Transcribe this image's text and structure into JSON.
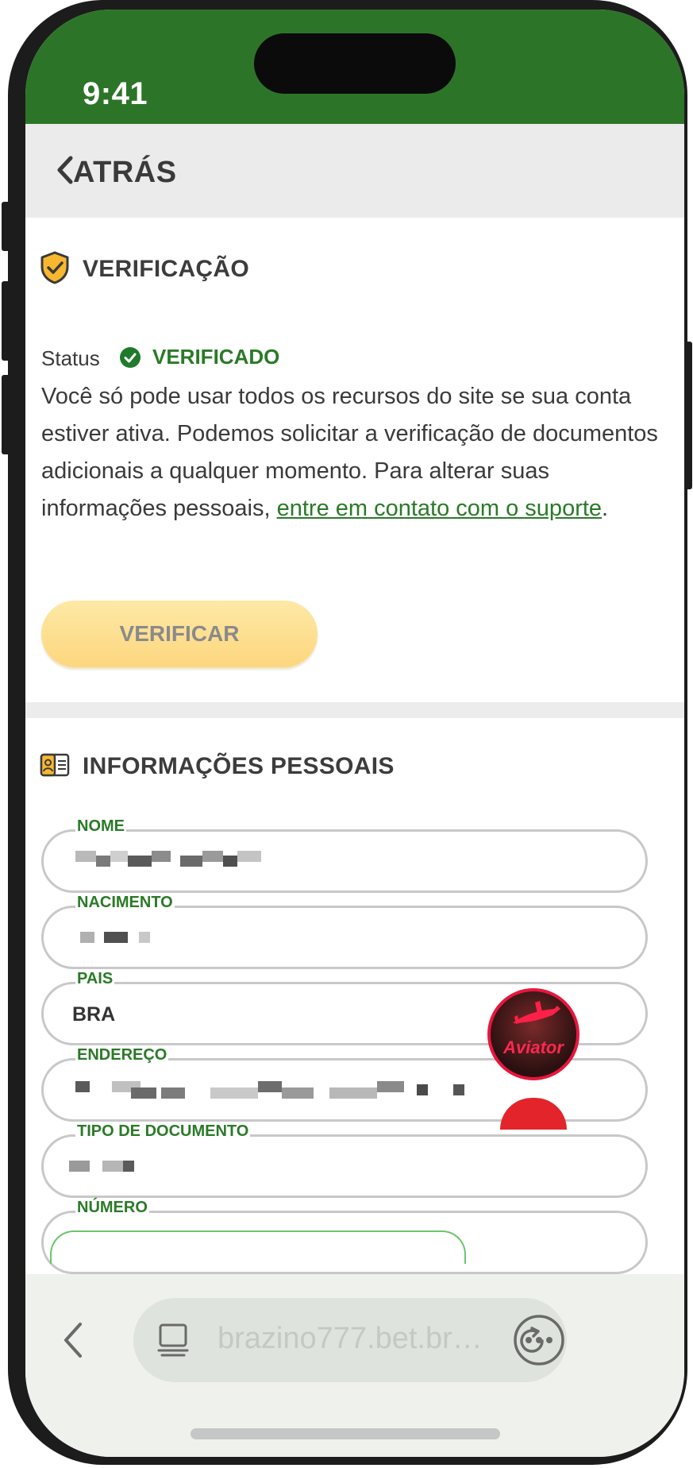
{
  "status_bar": {
    "time": "9:41"
  },
  "nav": {
    "back_label": "ATRÁS"
  },
  "verification": {
    "title": "VERIFICAÇÃO",
    "status_label": "Status",
    "status_value": "VERIFICADO",
    "description": "Você só pode usar todos os recursos do site se sua conta estiver ativa. Podemos solicitar a verificação de documentos adicionais a qualquer momento. Para alterar suas informações pessoais, ",
    "support_link": "entre em contato com o suporte",
    "description_end": ".",
    "verify_button": "VERIFICAR"
  },
  "personal_info": {
    "title": "INFORMAÇÕES PESSOAIS",
    "fields": [
      {
        "label": "NOME",
        "value": ""
      },
      {
        "label": "NACIMENTO",
        "value": ""
      },
      {
        "label": "PAIS",
        "value": "BRA"
      },
      {
        "label": "ENDEREÇO",
        "value": ""
      },
      {
        "label": "TIPO DE DOCUMENTO",
        "value": ""
      },
      {
        "label": "NÚMERO",
        "value": ""
      }
    ]
  },
  "floating_game": {
    "name": "Aviator"
  },
  "browser": {
    "url": "brazino777.bet.br…"
  },
  "colors": {
    "brand_green": "#2c7528",
    "accent_yellow": "#fdd67e",
    "link_green": "#2a7a27",
    "fab_red": "#e8163d"
  }
}
